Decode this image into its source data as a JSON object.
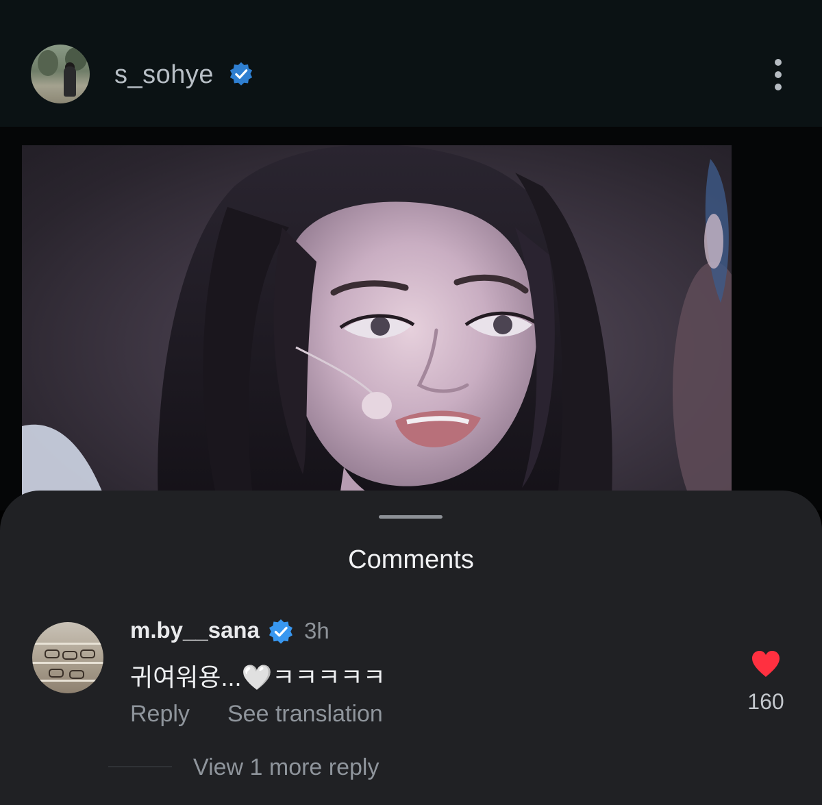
{
  "post": {
    "username": "s_sohye",
    "verified": true,
    "avatar_icon": "profile-photo",
    "menu_icon": "kebab-menu-icon"
  },
  "media": {
    "kind": "video-frame",
    "background_color": "#3f3744"
  },
  "comments_sheet": {
    "title": "Comments",
    "comment": {
      "username": "m.by__sana",
      "verified": true,
      "time": "3h",
      "text": "귀여워용...🤍ㅋㅋㅋㅋㅋ",
      "reply_label": "Reply",
      "translate_label": "See translation",
      "like_count": "160",
      "like_color": "#ff3040"
    },
    "view_more_replies": "View 1 more reply"
  },
  "colors": {
    "header_bg": "#0b1214",
    "sheet_bg": "#202124",
    "verified_blue": "#3897f0"
  }
}
